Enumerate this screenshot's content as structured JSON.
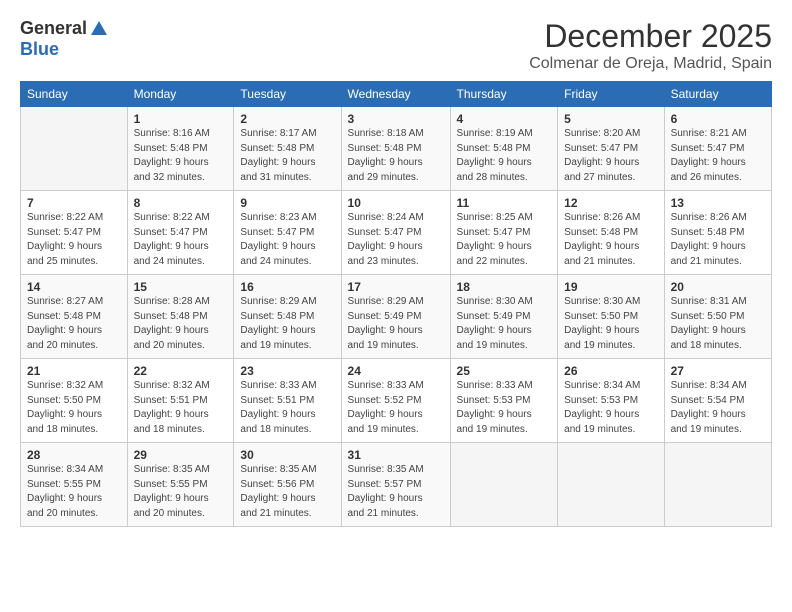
{
  "header": {
    "logo_general": "General",
    "logo_blue": "Blue",
    "month_title": "December 2025",
    "subtitle": "Colmenar de Oreja, Madrid, Spain"
  },
  "days_of_week": [
    "Sunday",
    "Monday",
    "Tuesday",
    "Wednesday",
    "Thursday",
    "Friday",
    "Saturday"
  ],
  "weeks": [
    [
      {
        "day": "",
        "info": ""
      },
      {
        "day": "1",
        "info": "Sunrise: 8:16 AM\nSunset: 5:48 PM\nDaylight: 9 hours\nand 32 minutes."
      },
      {
        "day": "2",
        "info": "Sunrise: 8:17 AM\nSunset: 5:48 PM\nDaylight: 9 hours\nand 31 minutes."
      },
      {
        "day": "3",
        "info": "Sunrise: 8:18 AM\nSunset: 5:48 PM\nDaylight: 9 hours\nand 29 minutes."
      },
      {
        "day": "4",
        "info": "Sunrise: 8:19 AM\nSunset: 5:48 PM\nDaylight: 9 hours\nand 28 minutes."
      },
      {
        "day": "5",
        "info": "Sunrise: 8:20 AM\nSunset: 5:47 PM\nDaylight: 9 hours\nand 27 minutes."
      },
      {
        "day": "6",
        "info": "Sunrise: 8:21 AM\nSunset: 5:47 PM\nDaylight: 9 hours\nand 26 minutes."
      }
    ],
    [
      {
        "day": "7",
        "info": "Sunrise: 8:22 AM\nSunset: 5:47 PM\nDaylight: 9 hours\nand 25 minutes."
      },
      {
        "day": "8",
        "info": "Sunrise: 8:22 AM\nSunset: 5:47 PM\nDaylight: 9 hours\nand 24 minutes."
      },
      {
        "day": "9",
        "info": "Sunrise: 8:23 AM\nSunset: 5:47 PM\nDaylight: 9 hours\nand 24 minutes."
      },
      {
        "day": "10",
        "info": "Sunrise: 8:24 AM\nSunset: 5:47 PM\nDaylight: 9 hours\nand 23 minutes."
      },
      {
        "day": "11",
        "info": "Sunrise: 8:25 AM\nSunset: 5:47 PM\nDaylight: 9 hours\nand 22 minutes."
      },
      {
        "day": "12",
        "info": "Sunrise: 8:26 AM\nSunset: 5:48 PM\nDaylight: 9 hours\nand 21 minutes."
      },
      {
        "day": "13",
        "info": "Sunrise: 8:26 AM\nSunset: 5:48 PM\nDaylight: 9 hours\nand 21 minutes."
      }
    ],
    [
      {
        "day": "14",
        "info": "Sunrise: 8:27 AM\nSunset: 5:48 PM\nDaylight: 9 hours\nand 20 minutes."
      },
      {
        "day": "15",
        "info": "Sunrise: 8:28 AM\nSunset: 5:48 PM\nDaylight: 9 hours\nand 20 minutes."
      },
      {
        "day": "16",
        "info": "Sunrise: 8:29 AM\nSunset: 5:48 PM\nDaylight: 9 hours\nand 19 minutes."
      },
      {
        "day": "17",
        "info": "Sunrise: 8:29 AM\nSunset: 5:49 PM\nDaylight: 9 hours\nand 19 minutes."
      },
      {
        "day": "18",
        "info": "Sunrise: 8:30 AM\nSunset: 5:49 PM\nDaylight: 9 hours\nand 19 minutes."
      },
      {
        "day": "19",
        "info": "Sunrise: 8:30 AM\nSunset: 5:50 PM\nDaylight: 9 hours\nand 19 minutes."
      },
      {
        "day": "20",
        "info": "Sunrise: 8:31 AM\nSunset: 5:50 PM\nDaylight: 9 hours\nand 18 minutes."
      }
    ],
    [
      {
        "day": "21",
        "info": "Sunrise: 8:32 AM\nSunset: 5:50 PM\nDaylight: 9 hours\nand 18 minutes."
      },
      {
        "day": "22",
        "info": "Sunrise: 8:32 AM\nSunset: 5:51 PM\nDaylight: 9 hours\nand 18 minutes."
      },
      {
        "day": "23",
        "info": "Sunrise: 8:33 AM\nSunset: 5:51 PM\nDaylight: 9 hours\nand 18 minutes."
      },
      {
        "day": "24",
        "info": "Sunrise: 8:33 AM\nSunset: 5:52 PM\nDaylight: 9 hours\nand 19 minutes."
      },
      {
        "day": "25",
        "info": "Sunrise: 8:33 AM\nSunset: 5:53 PM\nDaylight: 9 hours\nand 19 minutes."
      },
      {
        "day": "26",
        "info": "Sunrise: 8:34 AM\nSunset: 5:53 PM\nDaylight: 9 hours\nand 19 minutes."
      },
      {
        "day": "27",
        "info": "Sunrise: 8:34 AM\nSunset: 5:54 PM\nDaylight: 9 hours\nand 19 minutes."
      }
    ],
    [
      {
        "day": "28",
        "info": "Sunrise: 8:34 AM\nSunset: 5:55 PM\nDaylight: 9 hours\nand 20 minutes."
      },
      {
        "day": "29",
        "info": "Sunrise: 8:35 AM\nSunset: 5:55 PM\nDaylight: 9 hours\nand 20 minutes."
      },
      {
        "day": "30",
        "info": "Sunrise: 8:35 AM\nSunset: 5:56 PM\nDaylight: 9 hours\nand 21 minutes."
      },
      {
        "day": "31",
        "info": "Sunrise: 8:35 AM\nSunset: 5:57 PM\nDaylight: 9 hours\nand 21 minutes."
      },
      {
        "day": "",
        "info": ""
      },
      {
        "day": "",
        "info": ""
      },
      {
        "day": "",
        "info": ""
      }
    ]
  ]
}
